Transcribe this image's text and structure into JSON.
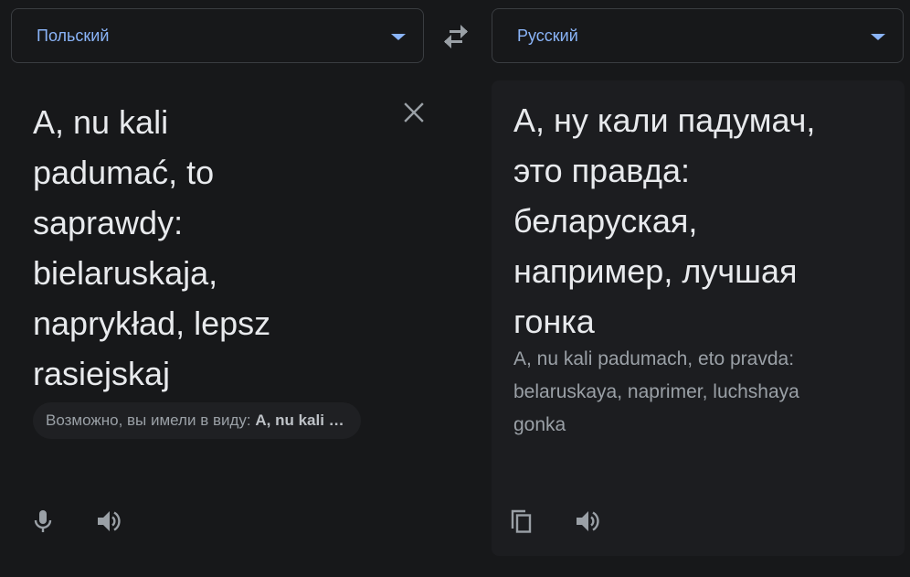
{
  "source_language": {
    "label": "Польский"
  },
  "target_language": {
    "label": "Русский"
  },
  "source": {
    "text": "A, nu kali\npadumać, to\nsaprawdy:\nbielaruskaja,\nnaprykład, lepsz\nrasiejskaj",
    "suggestion_prefix": "Возможно, вы имели в виду:",
    "suggestion_value": "A, nu kali …"
  },
  "target": {
    "text": "А, ну кали падумач,\nэто правда:\nбеларуская,\nнапример, лучшая\nгонка",
    "transliteration": "A, nu kali padumach, eto pravda:\nbelaruskaya, naprimer, luchshaya\ngonka"
  },
  "icons": {
    "swap": "swap-arrows-icon",
    "clear": "close-icon",
    "mic": "microphone-icon",
    "listen_source": "speaker-icon",
    "copy": "copy-icon",
    "listen_target": "speaker-icon"
  },
  "colors": {
    "accent": "#8ab4f8",
    "background": "#17181a",
    "panel": "#1c1d20",
    "text": "#e8eaed",
    "muted": "#9aa0a6"
  }
}
